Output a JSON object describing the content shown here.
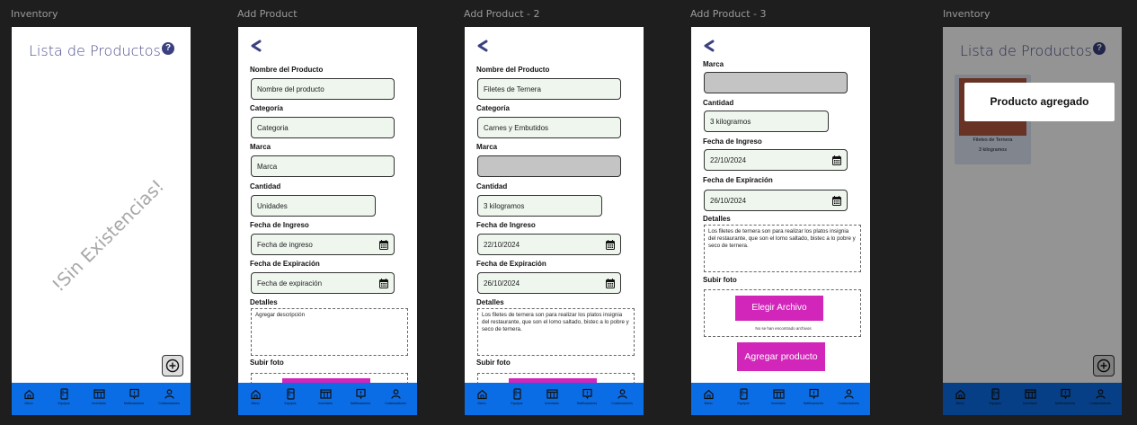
{
  "frames": {
    "f1": "Inventory",
    "f2": "Add Product",
    "f3": "Add Product - 2",
    "f4": "Add Product - 3",
    "f5": "Inventory"
  },
  "inventory": {
    "title": "Lista de Productos",
    "help": "?",
    "empty": "!Sin Existencias!"
  },
  "labels": {
    "nombre": "Nombre del Producto",
    "categoria": "Categoría",
    "marca": "Marca",
    "cantidad": "Cantidad",
    "ingreso": "Fecha de Ingreso",
    "expiracion": "Fecha de Expiración",
    "detalles": "Detalles",
    "foto": "Subir foto"
  },
  "add1": {
    "nombre": "Nombre del producto",
    "categoria": "Categoria",
    "marca": "Marca",
    "cantidad": "Unidades",
    "ingreso": "Fecha de ingreso",
    "expiracion": "Fecha de expiración",
    "detalles": "Agregar descripción"
  },
  "add2": {
    "nombre": "Filetes de Ternera",
    "categoria": "Carnes y Embutidos",
    "marca": "",
    "cantidad": "3 kilogramos",
    "ingreso": "22/10/2024",
    "expiracion": "26/10/2024",
    "detalles": "Los filetes de ternera son para realizar los platos insignia del restaurante, que son el lomo saltado, bistec a lo pobre y seco de ternera."
  },
  "add3": {
    "marca": "",
    "cantidad": "3 kilogramos",
    "ingreso": "22/10/2024",
    "expiracion": "26/10/2024",
    "detalles": "Los filetes de ternera son para realizar los platos insignia del restaurante, que son el lomo saltado, bistec a lo pobre y seco de ternera.",
    "elegir": "Elegir Archivo",
    "no_file": "No se han encontrado archivos",
    "agregar": "Agregar producto"
  },
  "toast": {
    "message": "Producto agregado",
    "card_name": "Filetes de Ternera",
    "card_qty": "3 kilogramos"
  },
  "nav": {
    "menu": "Menú",
    "equipos": "Equipos",
    "inventario": "Inventario",
    "notificaciones": "Notificaciones",
    "colaboradores": "Colaboradores"
  },
  "colors": {
    "accent": "#0b6de6",
    "brand_text": "#4a4e8a",
    "button": "#d126b9",
    "input_bg": "#eef6ee"
  },
  "icons": [
    "back-chevron-icon",
    "help-icon",
    "calendar-icon",
    "add-circle-icon",
    "home-icon",
    "fridge-icon",
    "inventory-icon",
    "notification-icon",
    "users-icon"
  ]
}
